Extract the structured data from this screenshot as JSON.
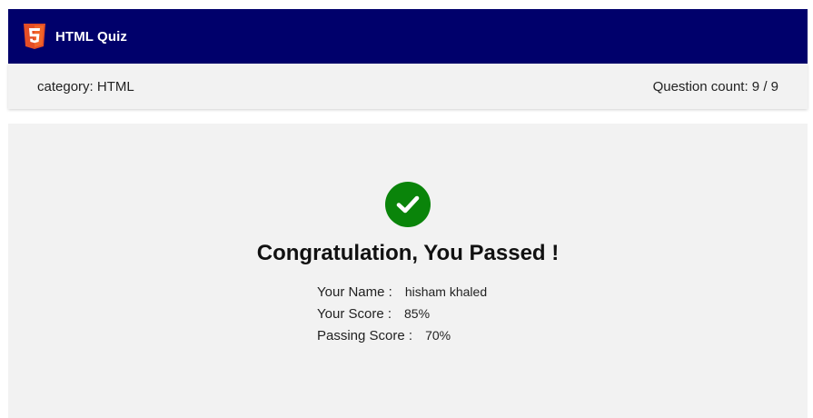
{
  "header": {
    "logo_icon": "html5-shield-icon",
    "title": "HTML Quiz",
    "background_color": "#00006b",
    "logo_color": "#e44d26"
  },
  "info_bar": {
    "category": "category: HTML",
    "question_count": "Question count: 9 / 9"
  },
  "result": {
    "status_icon": "check-circle-icon",
    "status_color": "#0a840a",
    "heading": "Congratulation, You Passed !",
    "details": [
      {
        "label": "Your Name :",
        "value": "hisham khaled"
      },
      {
        "label": "Your Score :",
        "value": "85%"
      },
      {
        "label": "Passing Score :",
        "value": "70%"
      }
    ]
  }
}
